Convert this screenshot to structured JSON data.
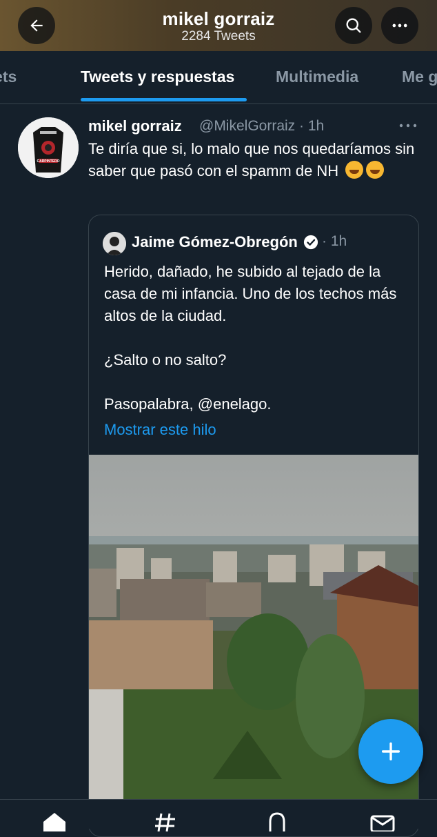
{
  "header": {
    "title": "mikel gorraiz",
    "subtitle": "2284 Tweets",
    "icons": {
      "back": "arrow-left-icon",
      "search": "search-icon",
      "more": "ellipsis-icon"
    }
  },
  "tabs": [
    {
      "label": "Tweets",
      "active": false
    },
    {
      "label": "Tweets y respuestas",
      "active": true
    },
    {
      "label": "Multimedia",
      "active": false
    },
    {
      "label": "Me gusta",
      "active": false
    }
  ],
  "tweet": {
    "author_name": "mikel gorraiz",
    "handle_time": "@MikelGorraiz · 1h",
    "text": "Te diría que si, lo malo que nos quedaríamos sin saber que pasó con el spamm de NH",
    "emoji_count": 2,
    "avatar_text": "CARPINTERO"
  },
  "quoted": {
    "author_name": "Jaime Gómez-Obregón",
    "time": "· 1h",
    "text": "Herido, dañado, he subido al tejado de la casa de mi infancia. Uno de los techos más altos de la ciudad.\n\n¿Salto o no salto?\n\nPasopalabra, @enelago.",
    "show_thread": "Mostrar este hilo"
  },
  "colors": {
    "accent": "#1d9bf0",
    "background": "#15202b",
    "muted": "#8b98a5",
    "border": "#38444d"
  },
  "bottom_nav": [
    "home-icon",
    "explore-icon",
    "notifications-icon",
    "messages-icon"
  ]
}
